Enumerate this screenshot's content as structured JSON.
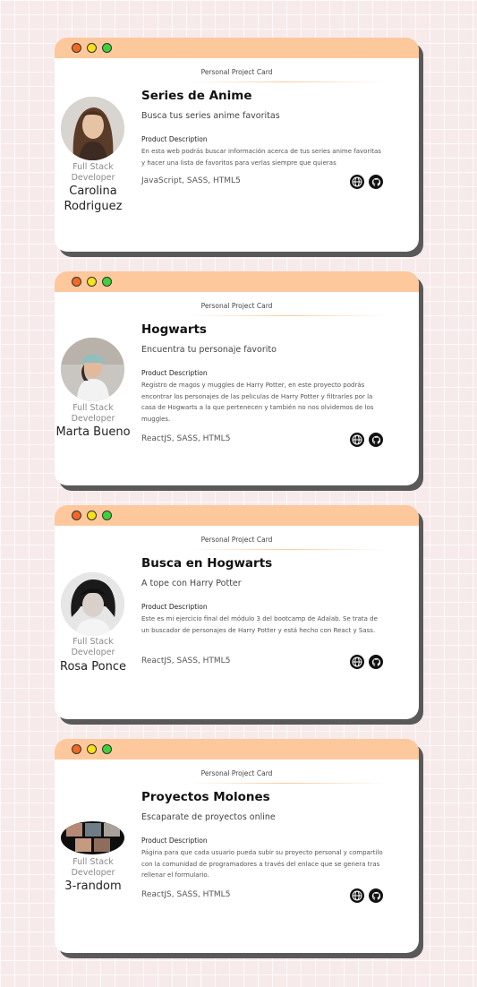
{
  "cards": [
    {
      "subtitle": "Personal Project Card",
      "name": "Series de Anime",
      "slogan": "Busca tus series anime favoritas",
      "desc_title": "Product Description",
      "desc": "En esta web podrás buscar información acerca de tus series anime favoritas y hacer una lista de favoritos para verlas siempre que quieras",
      "technologies": "JavaScript, SASS, HTML5",
      "job": "Full Stack Developer",
      "author": "Carolina Rodriguez",
      "photo_icon": "author-photo",
      "web_icon": "globe-icon",
      "repo_icon": "github-icon"
    },
    {
      "subtitle": "Personal Project Card",
      "name": "Hogwarts",
      "slogan": "Encuentra tu personaje favorito",
      "desc_title": "Product Description",
      "desc": "Registro de magos y muggles de Harry Potter, en este proyecto podrás encontrar los personajes de las peliculas de Harry Potter y filtrarles por la casa de Hogwarts a la que pertenecen y también no nos olvidemos de los muggles.",
      "technologies": "ReactJS, SASS, HTML5",
      "job": "Full Stack Developer",
      "author": "Marta Bueno",
      "photo_icon": "author-photo",
      "web_icon": "globe-icon",
      "repo_icon": "github-icon"
    },
    {
      "subtitle": "Personal Project Card",
      "name": "Busca en Hogwarts",
      "slogan": "A tope con Harry Potter",
      "desc_title": "Product Description",
      "desc": "Este es mi ejercicio final del módulo 3 del bootcamp de Adalab. Se trata de un buscador de personajes de Harry Potter y está hecho con React y Sass.",
      "technologies": "ReactJS, SASS, HTML5",
      "job": "Full Stack Developer",
      "author": "Rosa Ponce",
      "photo_icon": "author-photo",
      "web_icon": "globe-icon",
      "repo_icon": "github-icon"
    },
    {
      "subtitle": "Personal Project Card",
      "name": "Proyectos Molones",
      "slogan": "Escaparate de proyectos online",
      "desc_title": "Product Description",
      "desc": "Página para que cada usuario pueda subir su proyecto personal y compartilo con la comunidad de programadores a través del enlace que se genera tras rellenar el formulario.",
      "technologies": "ReactJS, SASS, HTML5",
      "job": "Full Stack Developer",
      "author": "3-random",
      "photo_icon": "author-photo",
      "web_icon": "globe-icon",
      "repo_icon": "github-icon"
    }
  ],
  "colors": {
    "background": "#f7eaea",
    "card_bar": "#fec89d",
    "dot_red": "#f26a21",
    "dot_yellow": "#f5e11c",
    "dot_green": "#3fd13a",
    "shadow": "#595959"
  }
}
